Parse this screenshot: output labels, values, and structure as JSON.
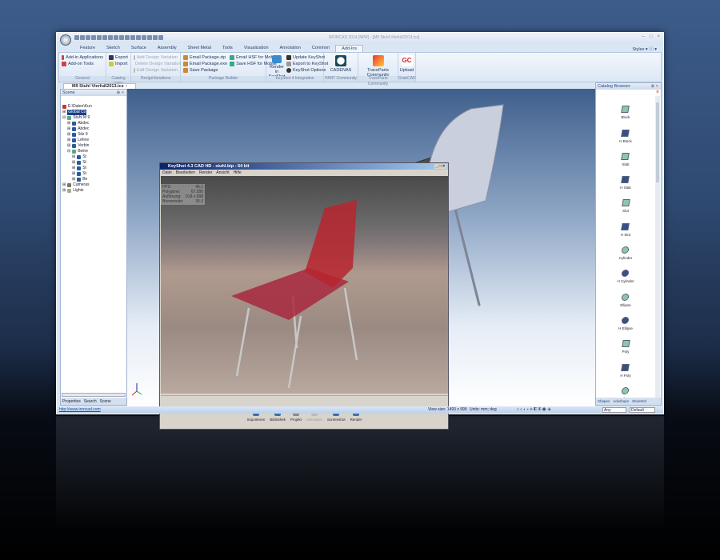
{
  "window": {
    "title": "IRONCAD 2014 [NPR] - [M9 Stuhl Vierfuß2013.ics]",
    "styles_label": "Styles"
  },
  "tabs": [
    "Feature",
    "Sketch",
    "Surface",
    "Assembly",
    "Sheet Metal",
    "Tools",
    "Visualization",
    "Annotation",
    "Common",
    "Add-Ins"
  ],
  "ribbon": {
    "general": {
      "label": "General",
      "items": [
        "Add-in Applications",
        "Add-on Tools"
      ]
    },
    "catalog_utility": {
      "label": "Catalog Utility",
      "items": [
        "Export",
        "Import"
      ]
    },
    "design_variations": {
      "label": "DesignVariations",
      "items": [
        "Add Design Variation",
        "Delete Design Variation",
        "Edit Design Variation"
      ]
    },
    "package_builder": {
      "label": "Package Builder",
      "items": [
        "Email Package.zip",
        "Email Package.exe",
        "Save Package",
        "Email HSF for Mobile",
        "Save HSF for Mobile"
      ]
    },
    "keyshot": {
      "label": "KeyShot 4 Integration",
      "big": "Render in KeyShot",
      "items": [
        "Update KeyShot",
        "Export to KeyShot",
        "KeyShot Options"
      ]
    },
    "part_community": {
      "label": "PART Community",
      "big": "CADENAS"
    },
    "traceparts": {
      "label": "TraceParts Community",
      "big": "TraceParts Community"
    },
    "grabcad": {
      "label": "GrabCAD",
      "big": "Upload"
    }
  },
  "document_tab": "M9 Stuhl Vierfuß2013.ics",
  "scene": {
    "title": "Scene",
    "tree": [
      "E:\\Daten\\Kun",
      "Global Co",
      "Stuhl M 9",
      "Abdec",
      "Abdec",
      "Sitz 9",
      "Lehne",
      "Verbin",
      "Beine",
      "St",
      "St",
      "St",
      "St",
      "Be",
      "Cameras",
      "Lights"
    ],
    "tabs": [
      "Properties",
      "Search",
      "Scene"
    ]
  },
  "keyshot": {
    "title": "KeyShot 4.3 CAD HD - stuhl.bip - 64 bit",
    "menu": [
      "Datei",
      "Bearbeiten",
      "Render",
      "Ansicht",
      "Hilfe"
    ],
    "stats": [
      {
        "k": "FPS:",
        "v": "45.1"
      },
      {
        "k": "Polygone:",
        "v": "67.280"
      },
      {
        "k": "Auflösung:",
        "v": "918 x 688"
      },
      {
        "k": "Brennweite:",
        "v": "35.0"
      }
    ],
    "toolbar": [
      "Importieren",
      "Bibliothek",
      "Projekt",
      "Animation",
      "Screenshot",
      "Render"
    ]
  },
  "catalog": {
    "title": "Catalog Browser",
    "items": [
      "Block",
      "H Block",
      "Slab",
      "H Slab",
      "Slot",
      "H Slot",
      "Cylinder",
      "H Cylinder",
      "Ellipse",
      "H Ellipse",
      "Poly",
      "H Poly",
      "Sphere"
    ],
    "tabs": [
      "Shapes",
      "Advshaps",
      "Sheetmtl"
    ]
  },
  "status": {
    "url": "http://www.ironcad.com",
    "view_size": "View size: 1493 x 999",
    "units": "Units: mm; deg",
    "select1": "Any",
    "select2": "Default"
  }
}
